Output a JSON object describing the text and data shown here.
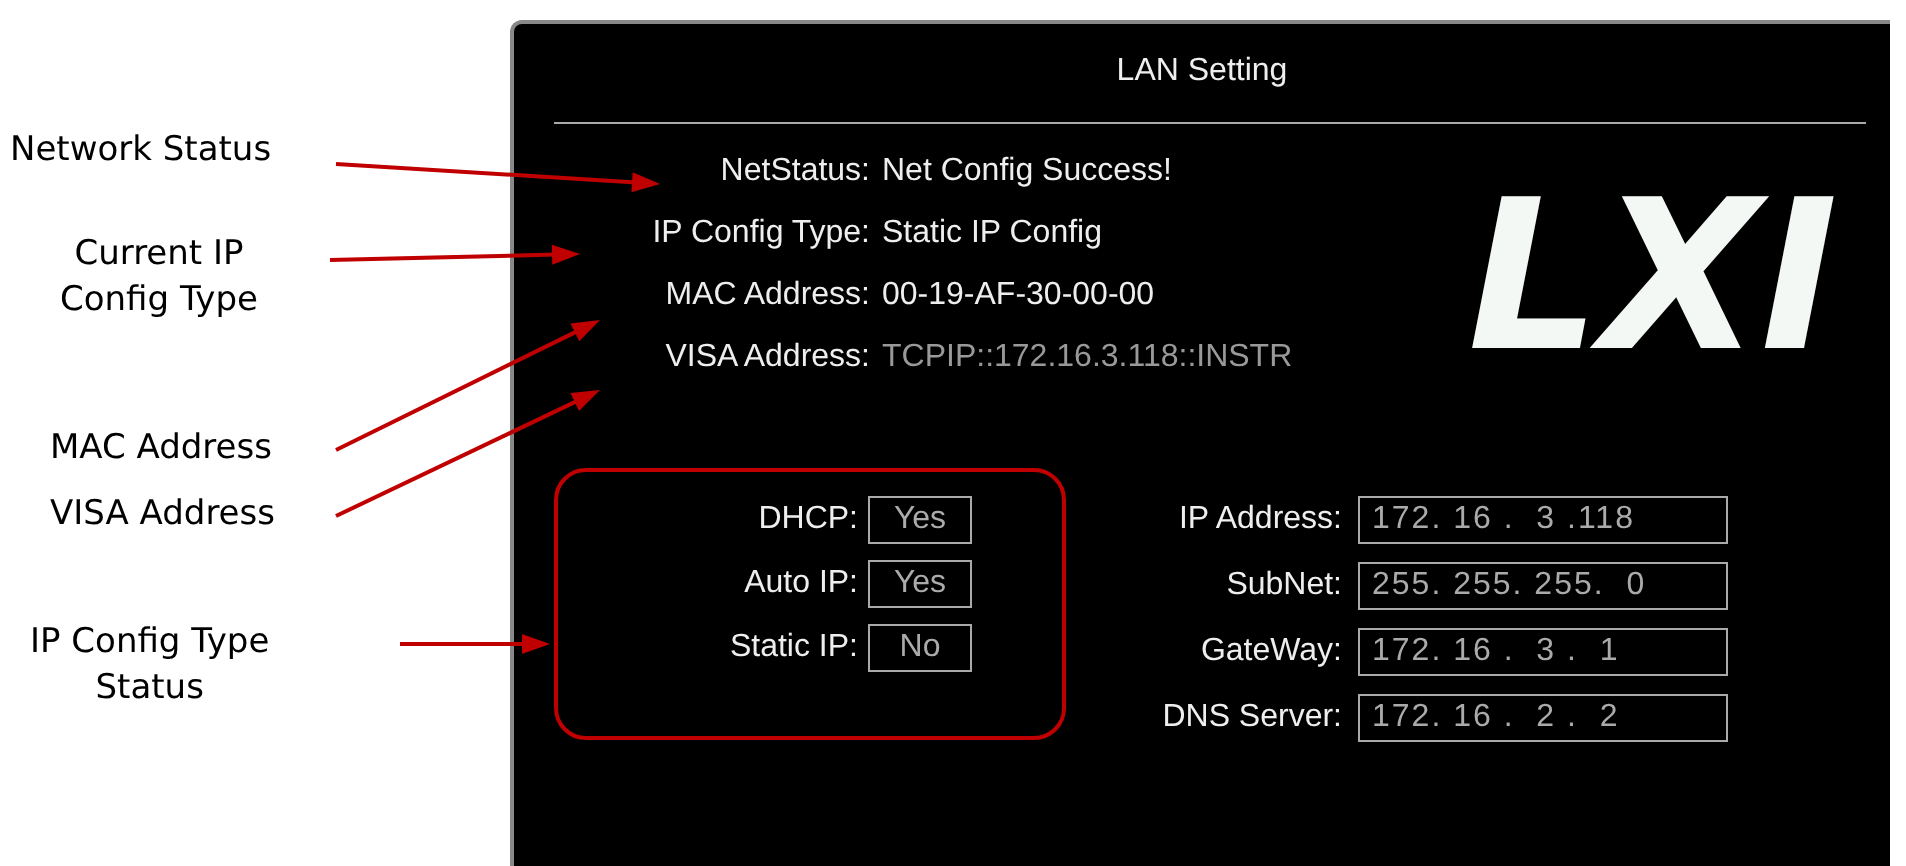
{
  "callouts": [
    {
      "text": "Network Status"
    },
    {
      "text": "Current IP\nConfig Type"
    },
    {
      "text": "MAC Address"
    },
    {
      "text": "VISA Address"
    },
    {
      "text": "IP Config Type\nStatus"
    }
  ],
  "screen": {
    "title": "LAN Setting",
    "logo": "LXI",
    "info": [
      {
        "label": "NetStatus:",
        "value": "Net Config Success!",
        "disabled": false
      },
      {
        "label": "IP Config Type:",
        "value": "Static IP Config",
        "disabled": false
      },
      {
        "label": "MAC Address:",
        "value": "00-19-AF-30-00-00",
        "disabled": false
      },
      {
        "label": "VISA Address:",
        "value": "TCPIP::172.16.3.118::INSTR",
        "disabled": true
      }
    ],
    "ip_modes": [
      {
        "label": "DHCP:",
        "value": "Yes"
      },
      {
        "label": "Auto IP:",
        "value": "Yes"
      },
      {
        "label": "Static IP:",
        "value": "No"
      }
    ],
    "network": [
      {
        "label": "IP Address:",
        "value": "172. 16 .  3 .118"
      },
      {
        "label": "SubNet:",
        "value": "255. 255. 255.  0"
      },
      {
        "label": "GateWay:",
        "value": "172. 16 .  3 .  1"
      },
      {
        "label": "DNS Server:",
        "value": "172. 16 .  2 .  2"
      }
    ]
  }
}
